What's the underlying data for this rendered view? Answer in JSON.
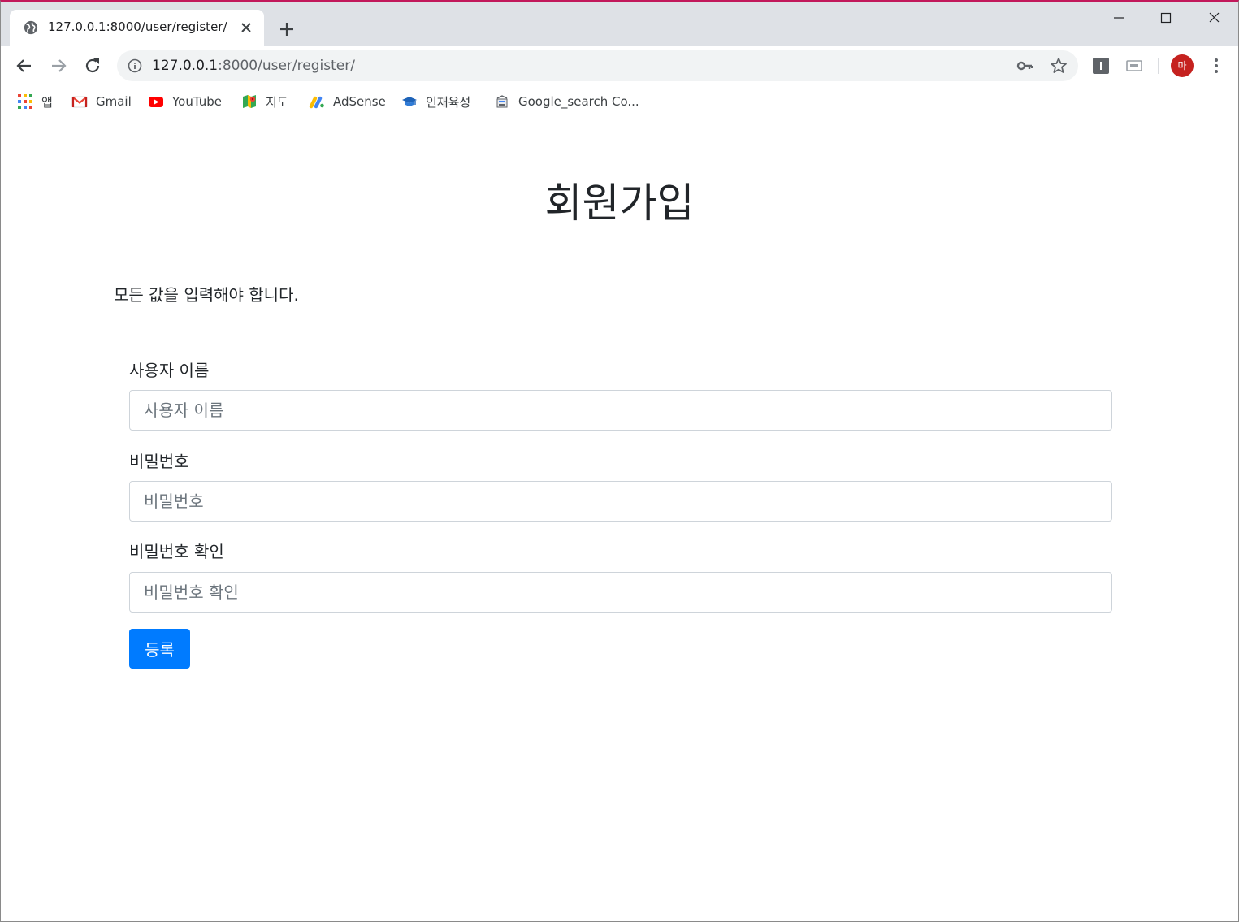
{
  "browser": {
    "tab": {
      "title": "127.0.0.1:8000/user/register/"
    },
    "omnibox": {
      "url_host": "127.0.0.1",
      "url_rest": ":8000/user/register/"
    },
    "avatar_label": "마",
    "bookmarks": [
      {
        "label": "앱",
        "icon": "apps-grid-icon"
      },
      {
        "label": "Gmail",
        "icon": "gmail-icon"
      },
      {
        "label": "YouTube",
        "icon": "youtube-icon"
      },
      {
        "label": "지도",
        "icon": "maps-icon"
      },
      {
        "label": "AdSense",
        "icon": "adsense-icon"
      },
      {
        "label": "인재육성",
        "icon": "graduation-cap-icon"
      },
      {
        "label": "Google_search Co...",
        "icon": "site-icon"
      }
    ],
    "colors": {
      "tabstrip": "#dee1e6",
      "omnibox": "#f1f3f4",
      "accent_frame": "#c2185b",
      "avatar": "#c5221f"
    }
  },
  "page": {
    "title": "회원가입",
    "notice": "모든 값을 입력해야 합니다.",
    "fields": [
      {
        "label": "사용자 이름",
        "placeholder": "사용자 이름",
        "value": ""
      },
      {
        "label": "비밀번호",
        "placeholder": "비밀번호",
        "value": ""
      },
      {
        "label": "비밀번호 확인",
        "placeholder": "비밀번호 확인",
        "value": ""
      }
    ],
    "submit_label": "등록",
    "colors": {
      "primary": "#007bff",
      "text": "#212529",
      "input_border": "#ced4da"
    }
  }
}
